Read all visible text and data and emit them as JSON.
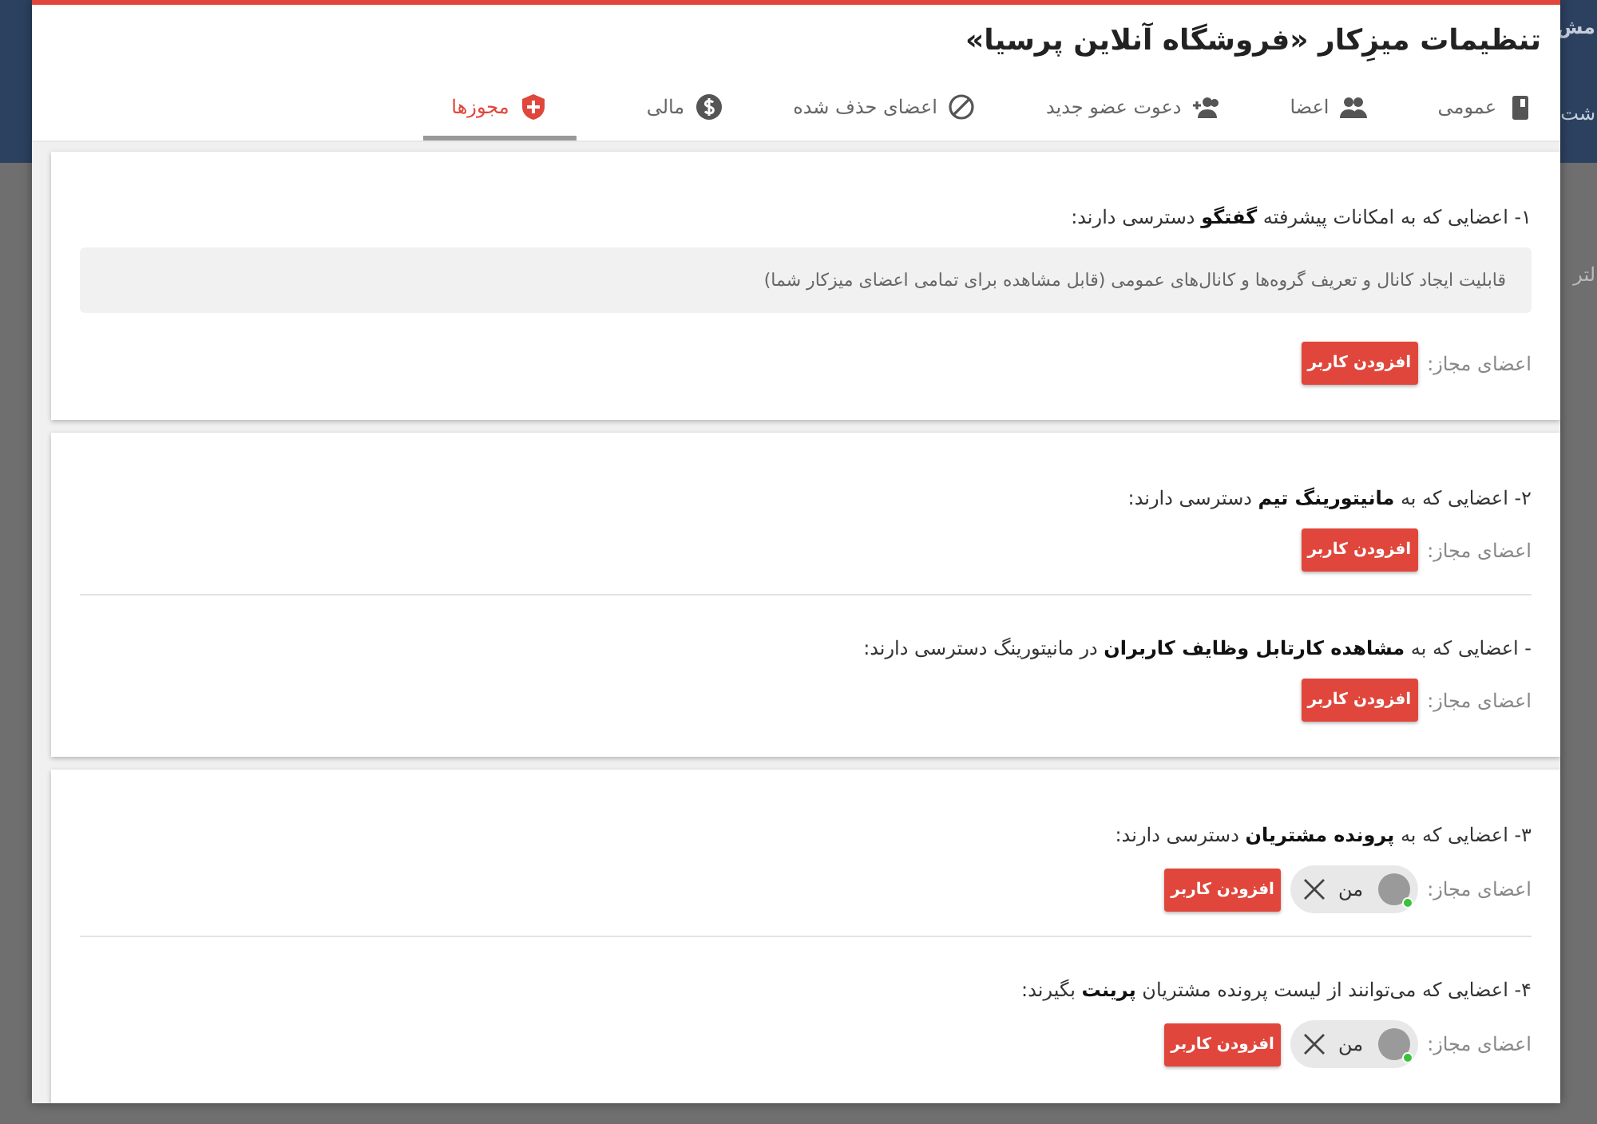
{
  "background": {
    "fragments": [
      "مش",
      "شت",
      "لتر"
    ]
  },
  "dialog": {
    "title": "تنظیمات میزِکار «فروشگاه آنلاین پرسیا»"
  },
  "tabs": [
    {
      "label": "عمومی",
      "selected": false
    },
    {
      "label": "اعضا",
      "selected": false
    },
    {
      "label": "دعوت عضو جدید",
      "selected": false
    },
    {
      "label": "اعضای حذف شده",
      "selected": false
    },
    {
      "label": "مالی",
      "selected": false
    },
    {
      "label": "مجوزها",
      "selected": true
    }
  ],
  "sections": [
    {
      "permissions": [
        {
          "text": "۱- اعضایی که به امکانات پیشرفته **گفتگو** دسترسی دارند:",
          "note": "قابلیت ایجاد کانال و تعریف گروه‌ها و کانال‌های عمومی (قابل مشاهده برای تمامی اعضای میزکار شما)",
          "members_label": "اعضای مجاز:",
          "button": "افزودن کاربر"
        }
      ]
    },
    {
      "permissions": [
        {
          "text": "۲- اعضایی که به **مانیتورینگ تیم** دسترسی دارند:",
          "members_label": "اعضای مجاز:",
          "button": "افزودن کاربر"
        },
        {
          "text": "- اعضایی که به **مشاهده کارتابل وظایف کاربران** در مانیتورینگ دسترسی دارند:",
          "members_label": "اعضای مجاز:",
          "button": "افزودن کاربر"
        }
      ]
    },
    {
      "permissions": [
        {
          "text": "۳- اعضایی که به **پرونده مشتریان** دسترسی دارند:",
          "members_label": "اعضای مجاز:",
          "members": [
            {
              "name": "من",
              "online": true
            }
          ],
          "button": "افزودن کاربر"
        },
        {
          "text": "۴- اعضایی که می‌توانند از لیست پرونده مشتریان **پرینت** بگیرند:",
          "members_label": "اعضای مجاز:",
          "members": [
            {
              "name": "من",
              "online": true
            }
          ],
          "button": "افزودن کاربر"
        }
      ]
    }
  ]
}
